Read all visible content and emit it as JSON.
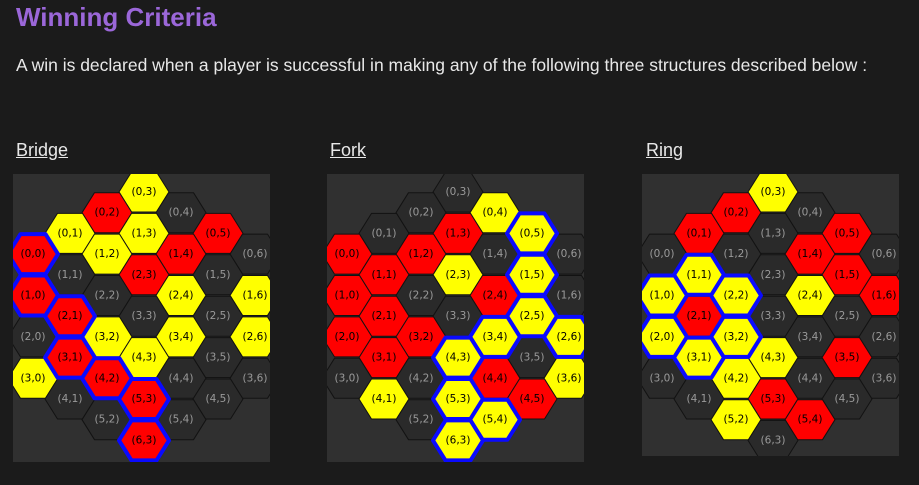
{
  "page": {
    "title": "Winning Criteria",
    "intro": "A win is declared when a player is successful in making any of the following three structures described below :"
  },
  "colors": {
    "background": "#1b1b1b",
    "panel": "#303030",
    "title": "#9b67d9",
    "empty_cell": "#2a2a2a",
    "empty_stroke": "#121212",
    "red": "#ff0000",
    "yellow": "#ffff00",
    "highlight": "#0a0aff"
  },
  "boards": [
    {
      "id": "bridge",
      "heading": "Bridge",
      "cells": [
        {
          "label": "(0,3)",
          "q": 0,
          "r": 3,
          "state": "yellow"
        },
        {
          "label": "(0,2)",
          "q": 0,
          "r": 2,
          "state": "red"
        },
        {
          "label": "(0,4)",
          "q": 0,
          "r": 4,
          "state": "empty"
        },
        {
          "label": "(0,1)",
          "q": 0,
          "r": 1,
          "state": "yellow"
        },
        {
          "label": "(1,3)",
          "q": 1,
          "r": 3,
          "state": "yellow"
        },
        {
          "label": "(0,5)",
          "q": 0,
          "r": 5,
          "state": "red"
        },
        {
          "label": "(0,0)",
          "q": 0,
          "r": 0,
          "state": "red",
          "hl": true
        },
        {
          "label": "(1,2)",
          "q": 1,
          "r": 2,
          "state": "yellow"
        },
        {
          "label": "(1,4)",
          "q": 1,
          "r": 4,
          "state": "red"
        },
        {
          "label": "(0,6)",
          "q": 0,
          "r": 6,
          "state": "empty"
        },
        {
          "label": "(1,1)",
          "q": 1,
          "r": 1,
          "state": "empty"
        },
        {
          "label": "(2,3)",
          "q": 2,
          "r": 3,
          "state": "red"
        },
        {
          "label": "(1,5)",
          "q": 1,
          "r": 5,
          "state": "empty"
        },
        {
          "label": "(1,0)",
          "q": 1,
          "r": 0,
          "state": "red",
          "hl": true
        },
        {
          "label": "(2,2)",
          "q": 2,
          "r": 2,
          "state": "empty"
        },
        {
          "label": "(2,4)",
          "q": 2,
          "r": 4,
          "state": "yellow"
        },
        {
          "label": "(1,6)",
          "q": 1,
          "r": 6,
          "state": "yellow"
        },
        {
          "label": "(2,1)",
          "q": 2,
          "r": 1,
          "state": "red",
          "hl": true
        },
        {
          "label": "(3,3)",
          "q": 3,
          "r": 3,
          "state": "empty"
        },
        {
          "label": "(2,5)",
          "q": 2,
          "r": 5,
          "state": "empty"
        },
        {
          "label": "(2,0)",
          "q": 2,
          "r": 0,
          "state": "empty"
        },
        {
          "label": "(3,2)",
          "q": 3,
          "r": 2,
          "state": "yellow"
        },
        {
          "label": "(3,4)",
          "q": 3,
          "r": 4,
          "state": "yellow"
        },
        {
          "label": "(2,6)",
          "q": 2,
          "r": 6,
          "state": "yellow"
        },
        {
          "label": "(3,1)",
          "q": 3,
          "r": 1,
          "state": "red",
          "hl": true
        },
        {
          "label": "(4,3)",
          "q": 4,
          "r": 3,
          "state": "yellow"
        },
        {
          "label": "(3,5)",
          "q": 3,
          "r": 5,
          "state": "empty"
        },
        {
          "label": "(3,0)",
          "q": 3,
          "r": 0,
          "state": "yellow"
        },
        {
          "label": "(4,2)",
          "q": 4,
          "r": 2,
          "state": "red",
          "hl": true
        },
        {
          "label": "(4,4)",
          "q": 4,
          "r": 4,
          "state": "empty"
        },
        {
          "label": "(3,6)",
          "q": 3,
          "r": 6,
          "state": "empty"
        },
        {
          "label": "(4,1)",
          "q": 4,
          "r": 1,
          "state": "empty"
        },
        {
          "label": "(5,3)",
          "q": 5,
          "r": 3,
          "state": "red",
          "hl": true
        },
        {
          "label": "(4,5)",
          "q": 4,
          "r": 5,
          "state": "empty"
        },
        {
          "label": "(5,2)",
          "q": 5,
          "r": 2,
          "state": "empty"
        },
        {
          "label": "(5,4)",
          "q": 5,
          "r": 4,
          "state": "empty"
        },
        {
          "label": "(6,3)",
          "q": 6,
          "r": 3,
          "state": "red",
          "hl": true
        }
      ]
    },
    {
      "id": "fork",
      "heading": "Fork",
      "cells": [
        {
          "label": "(0,3)",
          "q": 0,
          "r": 3,
          "state": "empty"
        },
        {
          "label": "(0,2)",
          "q": 0,
          "r": 2,
          "state": "empty"
        },
        {
          "label": "(0,4)",
          "q": 0,
          "r": 4,
          "state": "yellow"
        },
        {
          "label": "(0,1)",
          "q": 0,
          "r": 1,
          "state": "empty"
        },
        {
          "label": "(1,3)",
          "q": 1,
          "r": 3,
          "state": "red"
        },
        {
          "label": "(0,5)",
          "q": 0,
          "r": 5,
          "state": "yellow",
          "hl": true
        },
        {
          "label": "(0,0)",
          "q": 0,
          "r": 0,
          "state": "red"
        },
        {
          "label": "(1,2)",
          "q": 1,
          "r": 2,
          "state": "red"
        },
        {
          "label": "(1,4)",
          "q": 1,
          "r": 4,
          "state": "empty"
        },
        {
          "label": "(0,6)",
          "q": 0,
          "r": 6,
          "state": "empty"
        },
        {
          "label": "(1,1)",
          "q": 1,
          "r": 1,
          "state": "red"
        },
        {
          "label": "(2,3)",
          "q": 2,
          "r": 3,
          "state": "yellow"
        },
        {
          "label": "(1,5)",
          "q": 1,
          "r": 5,
          "state": "yellow",
          "hl": true
        },
        {
          "label": "(1,0)",
          "q": 1,
          "r": 0,
          "state": "red"
        },
        {
          "label": "(2,2)",
          "q": 2,
          "r": 2,
          "state": "empty"
        },
        {
          "label": "(2,4)",
          "q": 2,
          "r": 4,
          "state": "red"
        },
        {
          "label": "(1,6)",
          "q": 1,
          "r": 6,
          "state": "empty"
        },
        {
          "label": "(2,1)",
          "q": 2,
          "r": 1,
          "state": "red"
        },
        {
          "label": "(3,3)",
          "q": 3,
          "r": 3,
          "state": "empty"
        },
        {
          "label": "(2,5)",
          "q": 2,
          "r": 5,
          "state": "yellow",
          "hl": true
        },
        {
          "label": "(2,0)",
          "q": 2,
          "r": 0,
          "state": "red"
        },
        {
          "label": "(3,2)",
          "q": 3,
          "r": 2,
          "state": "red"
        },
        {
          "label": "(3,4)",
          "q": 3,
          "r": 4,
          "state": "yellow",
          "hl": true
        },
        {
          "label": "(2,6)",
          "q": 2,
          "r": 6,
          "state": "yellow",
          "hl": true
        },
        {
          "label": "(3,1)",
          "q": 3,
          "r": 1,
          "state": "red"
        },
        {
          "label": "(4,3)",
          "q": 4,
          "r": 3,
          "state": "yellow",
          "hl": true
        },
        {
          "label": "(3,5)",
          "q": 3,
          "r": 5,
          "state": "empty"
        },
        {
          "label": "(3,0)",
          "q": 3,
          "r": 0,
          "state": "empty"
        },
        {
          "label": "(4,2)",
          "q": 4,
          "r": 2,
          "state": "empty"
        },
        {
          "label": "(4,4)",
          "q": 4,
          "r": 4,
          "state": "red"
        },
        {
          "label": "(3,6)",
          "q": 3,
          "r": 6,
          "state": "yellow"
        },
        {
          "label": "(4,1)",
          "q": 4,
          "r": 1,
          "state": "yellow"
        },
        {
          "label": "(5,3)",
          "q": 5,
          "r": 3,
          "state": "yellow",
          "hl": true
        },
        {
          "label": "(4,5)",
          "q": 4,
          "r": 5,
          "state": "red"
        },
        {
          "label": "(5,2)",
          "q": 5,
          "r": 2,
          "state": "empty"
        },
        {
          "label": "(5,4)",
          "q": 5,
          "r": 4,
          "state": "yellow",
          "hl": true
        },
        {
          "label": "(6,3)",
          "q": 6,
          "r": 3,
          "state": "yellow",
          "hl": true
        }
      ]
    },
    {
      "id": "ring",
      "heading": "Ring",
      "cells": [
        {
          "label": "(0,3)",
          "q": 0,
          "r": 3,
          "state": "yellow"
        },
        {
          "label": "(0,2)",
          "q": 0,
          "r": 2,
          "state": "red"
        },
        {
          "label": "(0,4)",
          "q": 0,
          "r": 4,
          "state": "empty"
        },
        {
          "label": "(0,1)",
          "q": 0,
          "r": 1,
          "state": "red"
        },
        {
          "label": "(1,3)",
          "q": 1,
          "r": 3,
          "state": "empty"
        },
        {
          "label": "(0,5)",
          "q": 0,
          "r": 5,
          "state": "red"
        },
        {
          "label": "(0,0)",
          "q": 0,
          "r": 0,
          "state": "empty"
        },
        {
          "label": "(1,2)",
          "q": 1,
          "r": 2,
          "state": "empty"
        },
        {
          "label": "(1,4)",
          "q": 1,
          "r": 4,
          "state": "red"
        },
        {
          "label": "(0,6)",
          "q": 0,
          "r": 6,
          "state": "empty"
        },
        {
          "label": "(1,1)",
          "q": 1,
          "r": 1,
          "state": "yellow",
          "hl": true
        },
        {
          "label": "(2,3)",
          "q": 2,
          "r": 3,
          "state": "empty"
        },
        {
          "label": "(1,5)",
          "q": 1,
          "r": 5,
          "state": "red"
        },
        {
          "label": "(1,0)",
          "q": 1,
          "r": 0,
          "state": "yellow",
          "hl": true
        },
        {
          "label": "(2,2)",
          "q": 2,
          "r": 2,
          "state": "yellow",
          "hl": true
        },
        {
          "label": "(2,4)",
          "q": 2,
          "r": 4,
          "state": "yellow"
        },
        {
          "label": "(1,6)",
          "q": 1,
          "r": 6,
          "state": "red"
        },
        {
          "label": "(2,1)",
          "q": 2,
          "r": 1,
          "state": "red"
        },
        {
          "label": "(3,3)",
          "q": 3,
          "r": 3,
          "state": "empty"
        },
        {
          "label": "(2,5)",
          "q": 2,
          "r": 5,
          "state": "empty"
        },
        {
          "label": "(2,0)",
          "q": 2,
          "r": 0,
          "state": "yellow",
          "hl": true
        },
        {
          "label": "(3,2)",
          "q": 3,
          "r": 2,
          "state": "yellow",
          "hl": true
        },
        {
          "label": "(3,4)",
          "q": 3,
          "r": 4,
          "state": "empty"
        },
        {
          "label": "(2,6)",
          "q": 2,
          "r": 6,
          "state": "empty"
        },
        {
          "label": "(3,1)",
          "q": 3,
          "r": 1,
          "state": "yellow",
          "hl": true
        },
        {
          "label": "(4,3)",
          "q": 4,
          "r": 3,
          "state": "yellow"
        },
        {
          "label": "(3,5)",
          "q": 3,
          "r": 5,
          "state": "red"
        },
        {
          "label": "(3,0)",
          "q": 3,
          "r": 0,
          "state": "empty"
        },
        {
          "label": "(4,2)",
          "q": 4,
          "r": 2,
          "state": "yellow"
        },
        {
          "label": "(4,4)",
          "q": 4,
          "r": 4,
          "state": "empty"
        },
        {
          "label": "(3,6)",
          "q": 3,
          "r": 6,
          "state": "empty"
        },
        {
          "label": "(4,1)",
          "q": 4,
          "r": 1,
          "state": "empty"
        },
        {
          "label": "(5,3)",
          "q": 5,
          "r": 3,
          "state": "red"
        },
        {
          "label": "(4,5)",
          "q": 4,
          "r": 5,
          "state": "empty"
        },
        {
          "label": "(5,2)",
          "q": 5,
          "r": 2,
          "state": "yellow"
        },
        {
          "label": "(5,4)",
          "q": 5,
          "r": 4,
          "state": "red"
        },
        {
          "label": "(6,3)",
          "q": 6,
          "r": 3,
          "state": "empty"
        }
      ]
    }
  ]
}
